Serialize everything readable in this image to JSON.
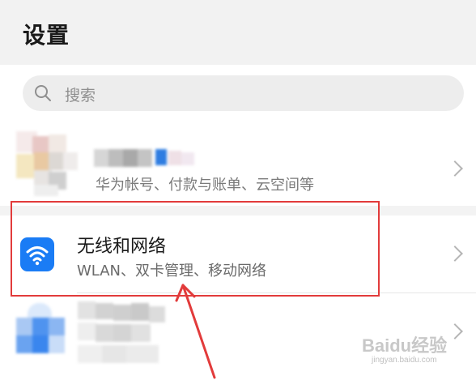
{
  "header": {
    "title": "设置"
  },
  "search": {
    "placeholder": "搜索",
    "icon": "search-icon"
  },
  "settings": [
    {
      "id": "account",
      "subtitle": "华为帐号、付款与账单、云空间等",
      "icon": "blurred-avatar"
    },
    {
      "id": "wireless",
      "title": "无线和网络",
      "subtitle": "WLAN、双卡管理、移动网络",
      "icon": "wifi-icon",
      "icon_color": "#1a7cf5",
      "highlighted": true
    },
    {
      "id": "next",
      "icon": "blurred-icon"
    }
  ],
  "annotation": {
    "highlight_color": "#e23b3b",
    "arrow": "red-arrow"
  },
  "watermark": {
    "text": "Baidu经验",
    "sub": "jingyan.baidu.com"
  }
}
